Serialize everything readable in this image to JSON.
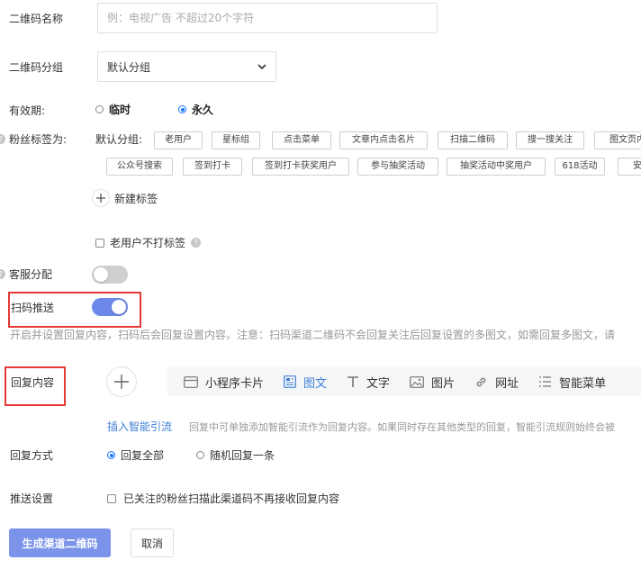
{
  "qr_name": {
    "label": "二维码名称",
    "placeholder": "例：电视广告 不超过20个字符",
    "value": ""
  },
  "qr_group": {
    "label": "二维码分组",
    "selected": "默认分组"
  },
  "validity": {
    "label": "有效期:",
    "options": [
      "临时",
      "永久"
    ],
    "selected": "永久"
  },
  "fan_tags": {
    "label": "粉丝标签为:",
    "default_label": "默认分组:",
    "row1": [
      "老用户",
      "星标组",
      "点击菜单",
      "文章内点击名片",
      "扫描二维码",
      "搜一搜关注",
      "图文页内"
    ],
    "row2": [
      "公众号搜索",
      "签到打卡",
      "签到打卡获奖用户",
      "参与抽奖活动",
      "抽奖活动中奖用户",
      "618活动",
      "安"
    ],
    "new_tag": "新建标签",
    "no_tag_old_user": "老用户不打标签"
  },
  "service_assign": {
    "label": "客服分配",
    "on": false
  },
  "scan_push": {
    "label": "扫码推送",
    "on": true,
    "hint": "开启并设置回复内容，扫码后会回复设置内容。注意：扫码渠道二维码不会回复关注后回复设置的多图文，如需回复多图文，请"
  },
  "reply_content": {
    "label": "回复内容",
    "tools": [
      {
        "label": "小程序卡片",
        "icon": "card-icon"
      },
      {
        "label": "图文",
        "icon": "article-icon",
        "active": true
      },
      {
        "label": "文字",
        "icon": "text-icon"
      },
      {
        "label": "图片",
        "icon": "image-icon"
      },
      {
        "label": "网址",
        "icon": "link-icon"
      },
      {
        "label": "智能菜单",
        "icon": "list-icon"
      }
    ],
    "smart_link": "插入智能引流",
    "smart_hint": "回复中可单独添加智能引流作为回复内容。如果同时存在其他类型的回复，智能引流规则始终会被"
  },
  "reply_mode": {
    "label": "回复方式",
    "options": [
      "回复全部",
      "随机回复一条"
    ],
    "selected": "回复全部"
  },
  "push_setting": {
    "label": "推送设置",
    "option": "已关注的粉丝扫描此渠道码不再接收回复内容"
  },
  "actions": {
    "primary": "生成渠道二维码",
    "cancel": "取消"
  },
  "colors": {
    "accent": "#1677ff",
    "toggle_on": "#6c88e8",
    "toggle_off": "#cfcfcf",
    "primary_button": "#7b93e8",
    "highlight": "#e53935",
    "link": "#3f7fd8"
  }
}
